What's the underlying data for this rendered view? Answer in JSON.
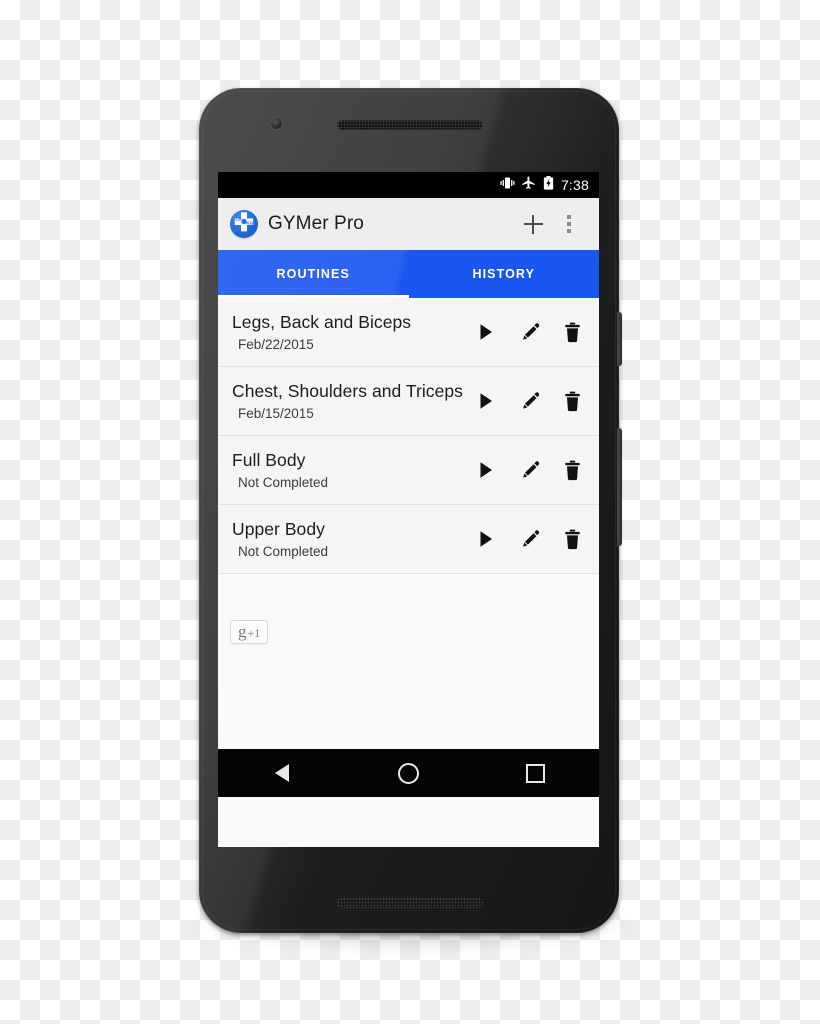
{
  "status_bar": {
    "icons": [
      "vibrate-icon",
      "airplane-mode-icon",
      "battery-charging-icon"
    ],
    "time": "7:38"
  },
  "toolbar": {
    "app_icon_name": "gymer-pro-app-icon",
    "app_icon_labels": {
      "left": "LB",
      "right": "KG"
    },
    "title": "GYMer Pro",
    "add_label": "+",
    "overflow_label": "⋮"
  },
  "tabs": {
    "items": [
      {
        "label": "ROUTINES",
        "active": true
      },
      {
        "label": "HISTORY",
        "active": false
      }
    ],
    "accent_color": "#1a56f0",
    "indicator_color": "#ffffff"
  },
  "routines": [
    {
      "title": "Legs, Back and Biceps",
      "subtitle": "Feb/22/2015"
    },
    {
      "title": "Chest, Shoulders and Triceps",
      "subtitle": "Feb/15/2015"
    },
    {
      "title": "Full Body",
      "subtitle": "Not Completed"
    },
    {
      "title": "Upper Body",
      "subtitle": "Not Completed"
    }
  ],
  "row_actions": {
    "play_label": "Start routine",
    "edit_label": "Edit routine",
    "delete_label": "Delete routine"
  },
  "plus_one": {
    "g": "g",
    "count": "+1"
  },
  "nav_bar": {
    "back": "Back",
    "home": "Home",
    "recents": "Recents"
  }
}
